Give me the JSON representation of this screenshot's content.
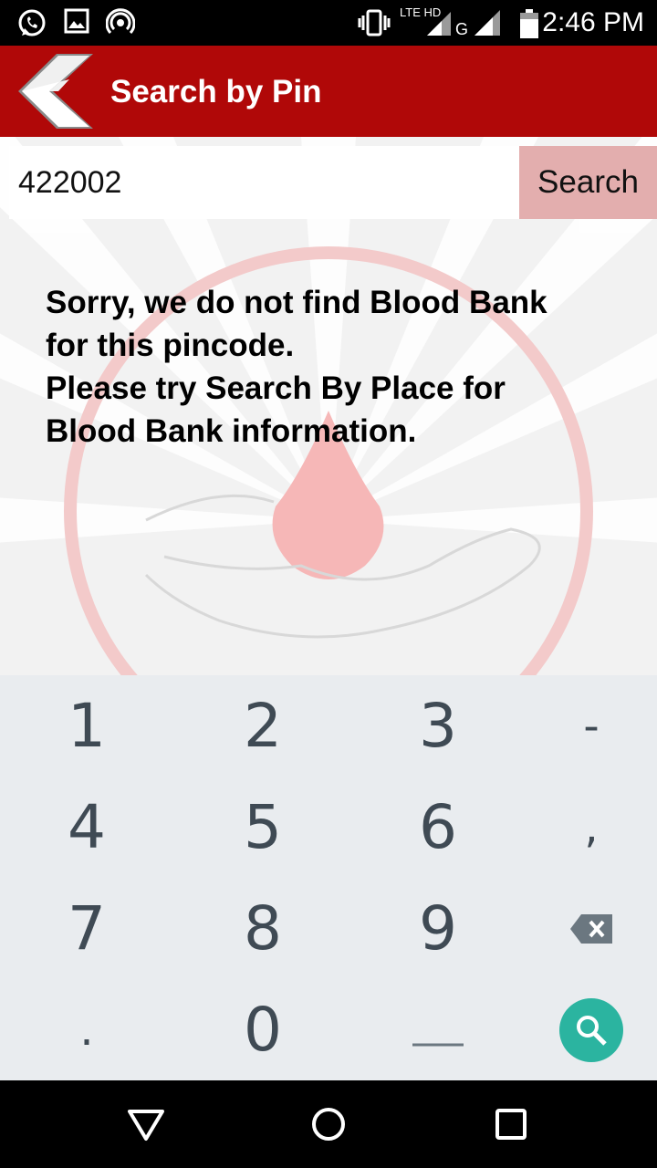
{
  "status_bar": {
    "time": "2:46 PM",
    "network": "LTE HD",
    "network_secondary": "G",
    "icons": [
      "whatsapp-icon",
      "image-icon",
      "hotspot-icon",
      "vibrate-icon",
      "signal-icon",
      "battery-icon"
    ]
  },
  "app_bar": {
    "title": "Search by Pin",
    "color": "#b00808"
  },
  "search": {
    "value": "422002",
    "button_label": "Search"
  },
  "message": {
    "lines": [
      "Sorry, we do not find Blood Bank",
      "for this pincode.",
      "Please try Search By Place for",
      "Blood Bank information."
    ]
  },
  "keyboard": {
    "keys": [
      "1",
      "2",
      "3",
      "-",
      "4",
      "5",
      "6",
      ",",
      "7",
      "8",
      "9",
      "backspace",
      ".",
      "0",
      "space",
      "search"
    ],
    "labels": {
      "k1": "1",
      "k2": "2",
      "k3": "3",
      "dash": "-",
      "k4": "4",
      "k5": "5",
      "k6": "6",
      "comma": ",",
      "k7": "7",
      "k8": "8",
      "k9": "9",
      "dot": ".",
      "k0": "0"
    },
    "action_color": "#2bb4a0"
  },
  "nav_bar": {
    "icons": [
      "back-triangle-icon",
      "home-circle-icon",
      "recents-square-icon"
    ]
  }
}
